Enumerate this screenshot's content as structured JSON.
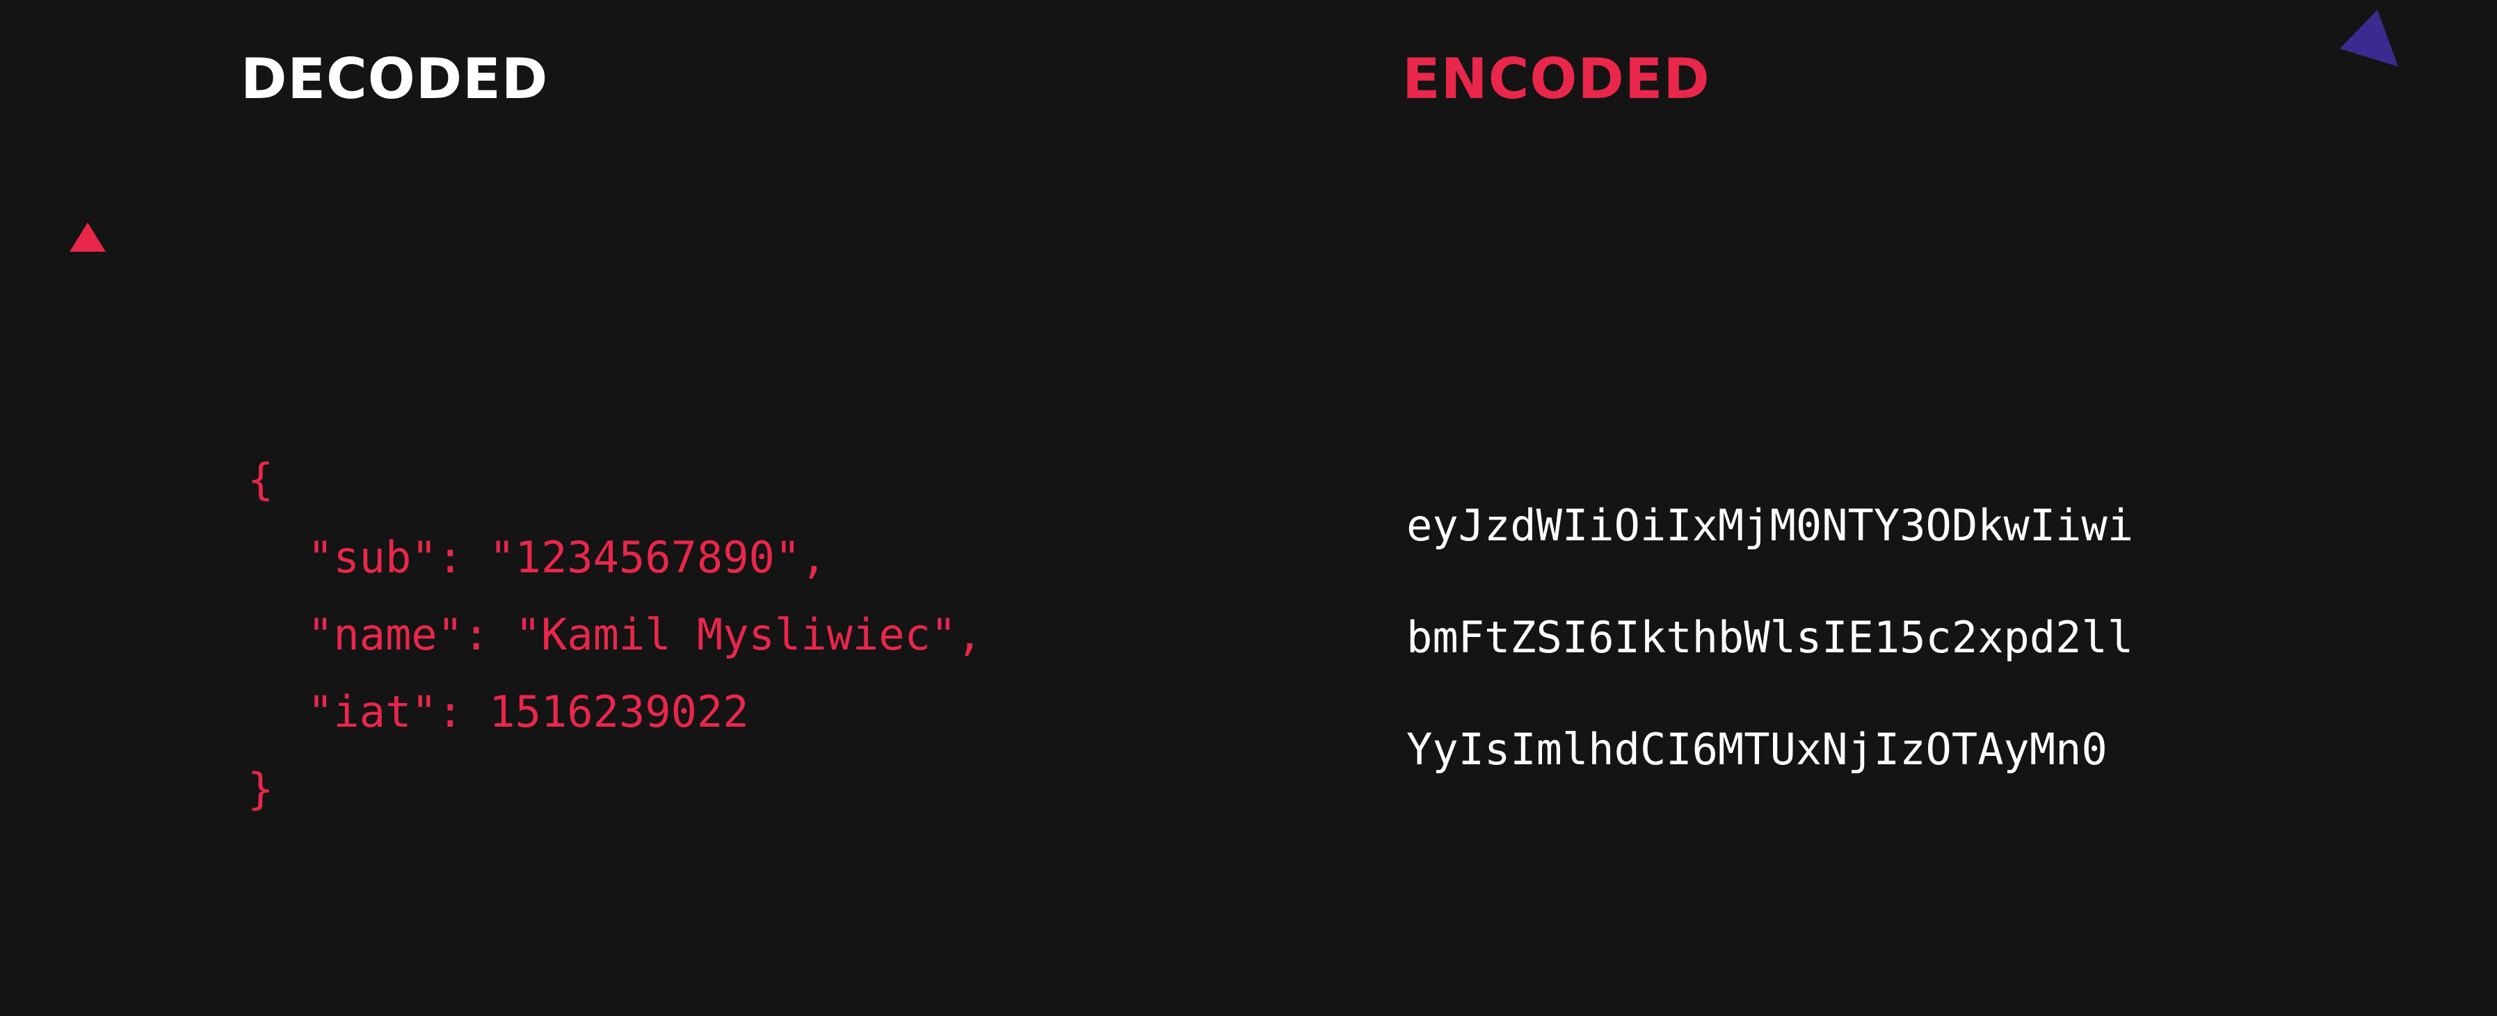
{
  "colors": {
    "background": "#141414",
    "accent_red": "#e8274a",
    "text_white": "#ffffff",
    "accent_purple": "#3d2a8f"
  },
  "decoded": {
    "heading": "DECODED",
    "lines": [
      "{",
      "\"sub\": \"1234567890\",",
      "\"name\": \"Kamil Mysliwiec\",",
      "\"iat\": 1516239022",
      "}"
    ]
  },
  "encoded": {
    "heading": "ENCODED",
    "lines": [
      "eyJzdWIiOiIxMjM0NTY3ODkwIiwi",
      "bmFtZSI6IkthbWlsIE15c2xpd2ll",
      "YyIsImlhdCI6MTUxNjIzOTAyMn0"
    ]
  },
  "decorations": [
    "red-triangle",
    "purple-triangle"
  ]
}
